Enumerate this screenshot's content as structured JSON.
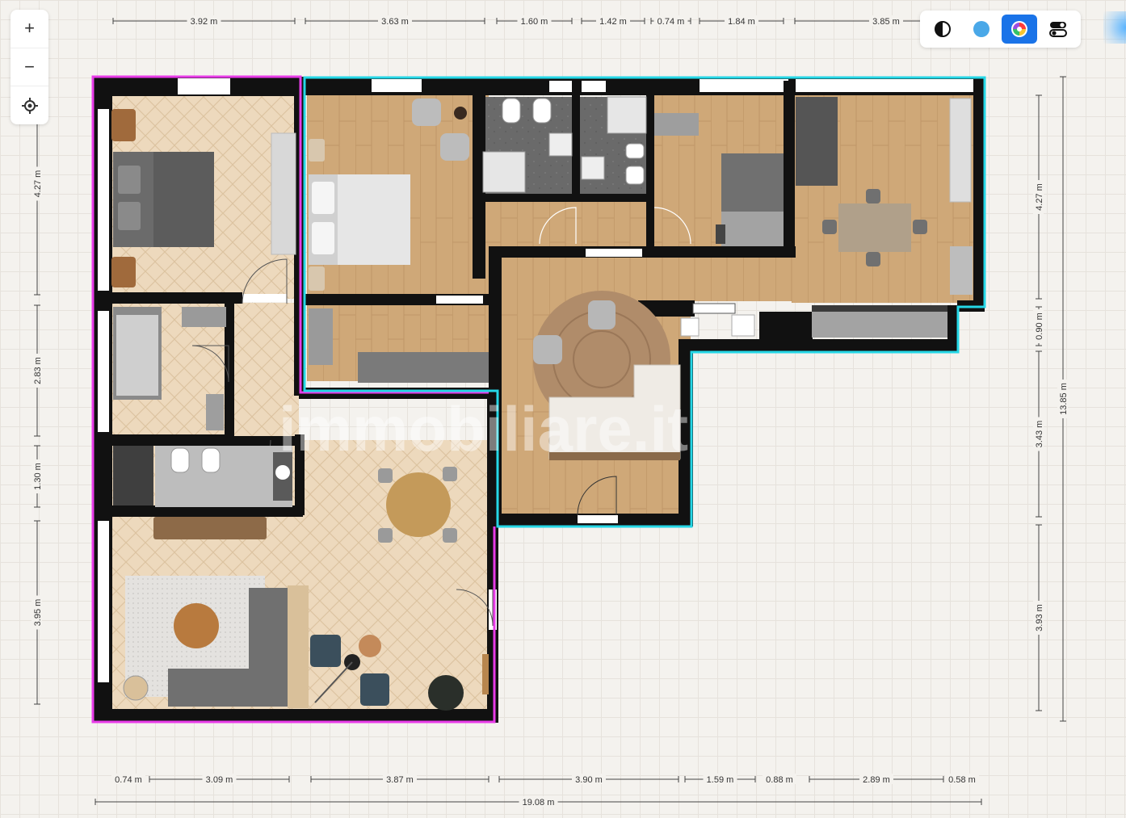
{
  "toolbar": {
    "zoom_in": "+",
    "zoom_out": "−",
    "locate": "⌖"
  },
  "theme_toolbar": {
    "accent": "#1a73e8",
    "buttons": [
      {
        "name": "contrast-icon",
        "active": false
      },
      {
        "name": "blue-dot-icon",
        "active": false
      },
      {
        "name": "color-wheel-icon",
        "active": true
      },
      {
        "name": "toggles-icon",
        "active": false
      }
    ]
  },
  "unit_colors": {
    "left": "#e83ce8",
    "right": "#25d7e6"
  },
  "dimensions": {
    "top": [
      "3.92 m",
      "3.63 m",
      "1.60 m",
      "1.42 m",
      "0.74 m",
      "1.84 m",
      "3.85 m"
    ],
    "bottom": [
      "0.74 m",
      "3.09 m",
      "3.87 m",
      "3.90 m",
      "1.59 m",
      "0.88 m",
      "2.89 m",
      "0.58 m"
    ],
    "bottom_total": "19.08 m",
    "left": [
      "4.27 m",
      "2.83 m",
      "1.30 m",
      "3.95 m"
    ],
    "right": [
      "4.27 m",
      "0.90 m",
      "3.43 m",
      "3.93 m"
    ],
    "right_total": "13.85 m"
  },
  "watermark": "immobiliare.it"
}
